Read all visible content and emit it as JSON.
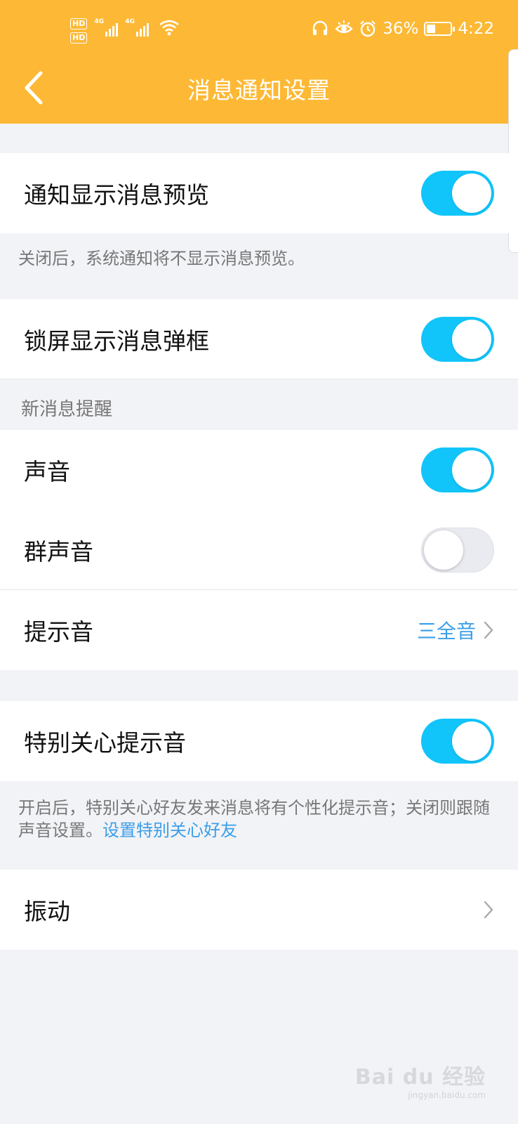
{
  "status_bar": {
    "hd1": "HD",
    "hd2": "HD",
    "network1": "4G",
    "network2": "4G",
    "battery": "36%",
    "time": "4:22",
    "icons": [
      "headset-icon",
      "eye-icon",
      "alarm-icon",
      "battery-icon",
      "wifi-icon",
      "signal-icon"
    ]
  },
  "header": {
    "title": "消息通知设置",
    "back_icon": "chevron-left-icon"
  },
  "settings": {
    "preview": {
      "label": "通知显示消息预览",
      "on": true
    },
    "preview_note": "关闭后，系统通知将不显示消息预览。",
    "lockscreen": {
      "label": "锁屏显示消息弹框",
      "on": true
    },
    "section_new_message": "新消息提醒",
    "sound": {
      "label": "声音",
      "on": true
    },
    "group_sound": {
      "label": "群声音",
      "on": false
    },
    "ringtone": {
      "label": "提示音",
      "value": "三全音"
    },
    "special_care": {
      "label": "特别关心提示音",
      "on": true
    },
    "special_note": "开启后，特别关心好友发来消息将有个性化提示音；关闭则跟随声音设置。",
    "special_link": "设置特别关心好友",
    "vibration": {
      "label": "振动"
    }
  },
  "watermark": {
    "text": "Bai du 经验",
    "sub": "jingyan.baidu.com"
  },
  "colors": {
    "header_bg": "#fdb935",
    "toggle_on": "#11c5fb",
    "toggle_off": "#e9ebf1",
    "link": "#3a9ee8",
    "page_bg": "#f2f3f7"
  }
}
